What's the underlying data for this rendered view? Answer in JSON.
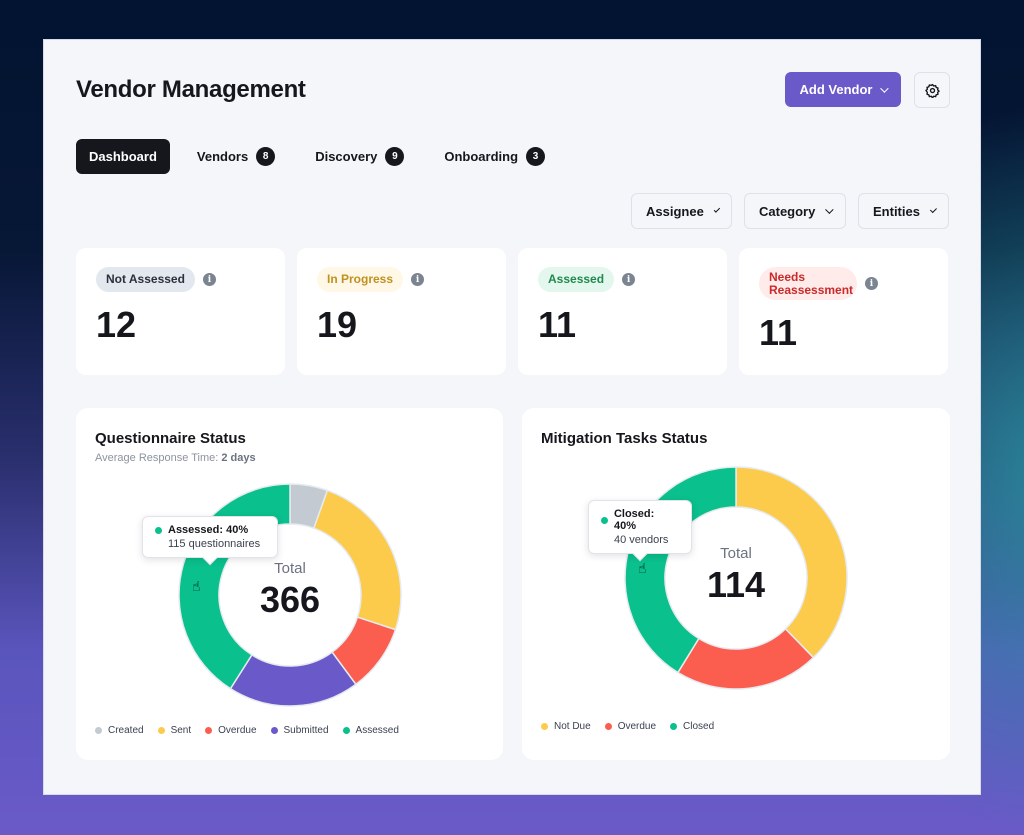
{
  "header": {
    "title": "Vendor Management",
    "add_vendor_label": "Add Vendor",
    "settings_icon": "gear-icon"
  },
  "tabs": [
    {
      "label": "Dashboard",
      "active": true
    },
    {
      "label": "Vendors",
      "badge": "8"
    },
    {
      "label": "Discovery",
      "badge": "9"
    },
    {
      "label": "Onboarding",
      "badge": "3"
    }
  ],
  "filters": [
    {
      "label": "Assignee"
    },
    {
      "label": "Category"
    },
    {
      "label": "Entities"
    }
  ],
  "stats": [
    {
      "label": "Not Assessed",
      "value": "12",
      "bg": "#e3e7ee",
      "fg": "#2b303b"
    },
    {
      "label": "In Progress",
      "value": "19",
      "bg": "#fff8e6",
      "fg": "#c09020"
    },
    {
      "label": "Assessed",
      "value": "11",
      "bg": "#e4f7ee",
      "fg": "#1f8a4c"
    },
    {
      "label": "Needs Reassessment",
      "value": "11",
      "bg": "#ffecea",
      "fg": "#c92a2a"
    }
  ],
  "info_icon_glyph": "i",
  "questionnaire": {
    "title": "Questionnaire Status",
    "subtitle_label": "Average Response Time:",
    "subtitle_value": "2 days",
    "center_label": "Total",
    "center_value": "366",
    "tooltip_title": "Assessed: 40%",
    "tooltip_detail": "115 questionnaires"
  },
  "mitigation": {
    "title": "Mitigation Tasks Status",
    "center_label": "Total",
    "center_value": "114",
    "tooltip_title": "Closed: 40%",
    "tooltip_detail": "40 vendors"
  },
  "cursor_glyph": "☝",
  "chart_data": [
    {
      "type": "pie",
      "title": "Questionnaire Status",
      "subtitle": "Average Response Time: 2 days",
      "total": 366,
      "categories": [
        "Created",
        "Sent",
        "Overdue",
        "Submitted",
        "Assessed"
      ],
      "values": [
        20,
        90,
        36,
        70,
        150
      ],
      "colors": [
        "#c3cad2",
        "#fdcb4b",
        "#fb5e4f",
        "#6a59c9",
        "#0ac08d"
      ],
      "legend": "bottom-left"
    },
    {
      "type": "pie",
      "title": "Mitigation Tasks Status",
      "total": 114,
      "categories": [
        "Not Due",
        "Overdue",
        "Closed"
      ],
      "values": [
        43,
        24,
        47
      ],
      "colors": [
        "#fdcb4b",
        "#fb5e4f",
        "#0ac08d"
      ],
      "legend": "bottom-left"
    }
  ]
}
